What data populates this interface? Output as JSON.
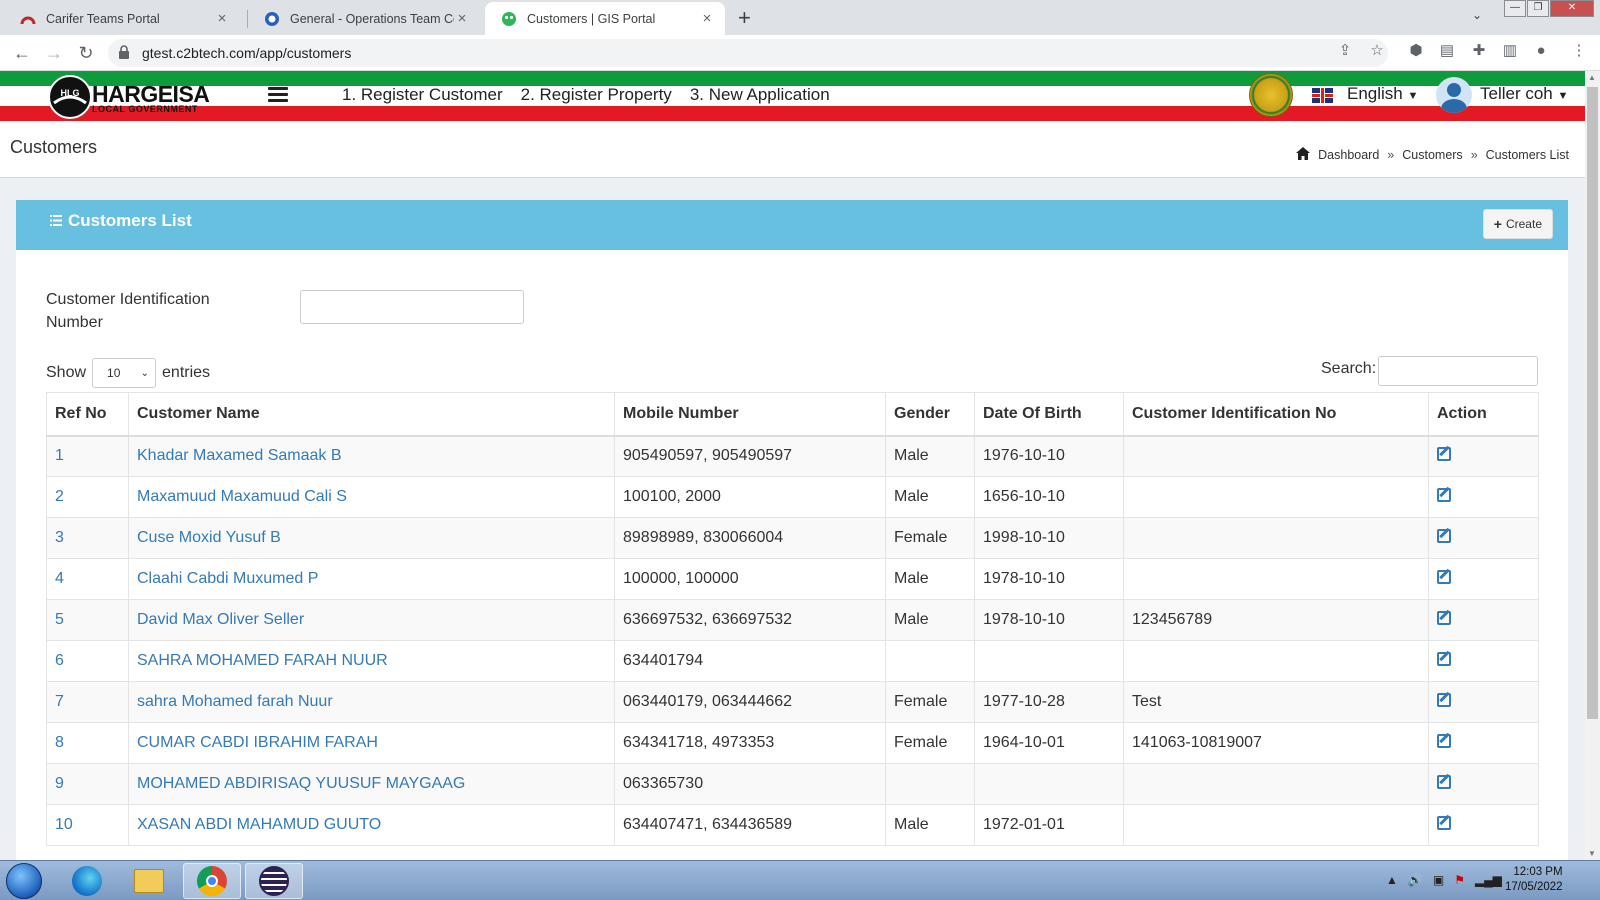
{
  "browser": {
    "tabs": [
      {
        "title": "Carifer Teams Portal",
        "active": false
      },
      {
        "title": "General - Operations Team Colla",
        "active": false
      },
      {
        "title": "Customers | GIS Portal",
        "active": true
      }
    ],
    "url": "gtest.c2btech.com/app/customers"
  },
  "header": {
    "logo_text": "HARGEISA",
    "logo_subtext": "LOCAL GOVERNMENT",
    "logo_mark": "HLG",
    "nav": [
      {
        "label": "1. Register Customer"
      },
      {
        "label": "2. Register Property"
      },
      {
        "label": "3. New Application"
      }
    ],
    "language": "English",
    "user": "Teller coh"
  },
  "page": {
    "title": "Customers",
    "breadcrumb": [
      "Dashboard",
      "Customers",
      "Customers List"
    ],
    "breadcrumb_sep": "»"
  },
  "box": {
    "title": "Customers List",
    "create_label": "Create",
    "filter_label": "Customer Identification Number",
    "filter_value": "",
    "show_label": "Show",
    "entries_value": "10",
    "entries_label": "entries",
    "search_label": "Search:",
    "search_value": ""
  },
  "table": {
    "columns": [
      "Ref No",
      "Customer Name",
      "Mobile Number",
      "Gender",
      "Date Of Birth",
      "Customer Identification No",
      "Action"
    ],
    "rows": [
      {
        "ref": "1",
        "name": "Khadar Maxamed Samaak B",
        "mobile": "905490597, 905490597",
        "gender": "Male",
        "dob": "1976-10-10",
        "cid": ""
      },
      {
        "ref": "2",
        "name": "Maxamuud Maxamuud Cali S",
        "mobile": "100100, 2000",
        "gender": "Male",
        "dob": "1656-10-10",
        "cid": ""
      },
      {
        "ref": "3",
        "name": "Cuse Moxid Yusuf B",
        "mobile": "89898989, 830066004",
        "gender": "Female",
        "dob": "1998-10-10",
        "cid": ""
      },
      {
        "ref": "4",
        "name": "Claahi Cabdi Muxumed P",
        "mobile": "100000, 100000",
        "gender": "Male",
        "dob": "1978-10-10",
        "cid": ""
      },
      {
        "ref": "5",
        "name": "David Max Oliver Seller",
        "mobile": "636697532, 636697532",
        "gender": "Male",
        "dob": "1978-10-10",
        "cid": "123456789"
      },
      {
        "ref": "6",
        "name": "SAHRA MOHAMED FARAH NUUR",
        "mobile": "634401794",
        "gender": "",
        "dob": "",
        "cid": ""
      },
      {
        "ref": "7",
        "name": "sahra Mohamed farah Nuur",
        "mobile": "063440179, 063444662",
        "gender": "Female",
        "dob": "1977-10-28",
        "cid": "Test"
      },
      {
        "ref": "8",
        "name": "CUMAR CABDI IBRAHIM FARAH",
        "mobile": "634341718, 4973353",
        "gender": "Female",
        "dob": "1964-10-01",
        "cid": "141063-10819007"
      },
      {
        "ref": "9",
        "name": "MOHAMED ABDIRISAQ YUUSUF MAYGAAG",
        "mobile": "063365730",
        "gender": "",
        "dob": "",
        "cid": ""
      },
      {
        "ref": "10",
        "name": "XASAN ABDI MAHAMUD GUUTO",
        "mobile": "634407471, 634436589",
        "gender": "Male",
        "dob": "1972-01-01",
        "cid": ""
      }
    ]
  },
  "taskbar": {
    "time": "12:03 PM",
    "date": "17/05/2022"
  },
  "colors": {
    "accent_header": "#68c0e0",
    "link": "#337ab7",
    "flag_green": "#0f9b3c",
    "flag_red": "#e31a24"
  }
}
